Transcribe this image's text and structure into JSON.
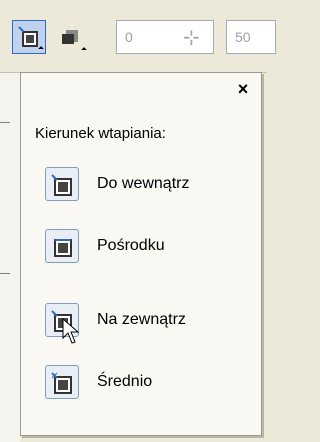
{
  "toolbar": {
    "field1_value": "0",
    "field2_value": "50"
  },
  "popup": {
    "close_label": "×",
    "heading": "Kierunek wtapiania:",
    "options": [
      {
        "label": "Do wewnątrz",
        "icon": "feather-inside-icon"
      },
      {
        "label": "Pośrodku",
        "icon": "feather-middle-icon"
      },
      {
        "label": "Na zewnątrz",
        "icon": "feather-outside-icon"
      },
      {
        "label": "Średnio",
        "icon": "feather-average-icon"
      }
    ]
  },
  "colors": {
    "accent": "#316ac5",
    "icon_dark": "#3c3c3c",
    "icon_light": "#c8c8c8"
  }
}
